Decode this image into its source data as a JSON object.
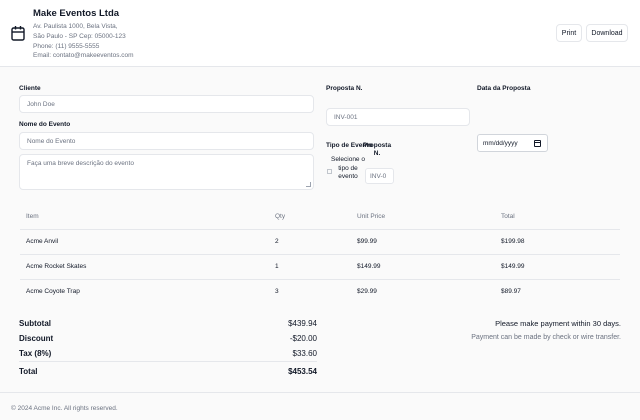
{
  "header": {
    "company_name": "Make Eventos Ltda",
    "address_lines": [
      "Av. Paulista 1000, Bela Vista,",
      "São Paulo - SP Cep: 05000-123",
      "Phone: (11) 9555-5555",
      "Email: contato@makeeventos.com"
    ],
    "print_label": "Print",
    "download_label": "Download",
    "icon": "calendar-icon"
  },
  "form": {
    "client_label": "Cliente",
    "client_placeholder": "John Doe",
    "event_name_label": "Nome do Evento",
    "event_name_placeholder": "Nome do Evento",
    "event_description_placeholder": "Faça uma breve descrição do evento",
    "proposal_number_label": "Proposta N.",
    "proposal_number_placeholder": "INV-001",
    "proposal_date_label": "Data da Proposta",
    "proposal_date_value": "mm/dd/yyyy",
    "event_type_label": "Tipo de Evento",
    "event_type_select": "Selecione o tipo de evento",
    "proposal_number_label_2": "Proposta N.",
    "proposal_number_placeholder_2": "INV-0"
  },
  "table": {
    "headers": [
      "Item",
      "Qty",
      "Unit Price",
      "Total"
    ],
    "rows": [
      {
        "item": "Acme Anvil",
        "qty": "2",
        "unit_price": "$99.99",
        "total": "$199.98"
      },
      {
        "item": "Acme Rocket Skates",
        "qty": "1",
        "unit_price": "$149.99",
        "total": "$149.99"
      },
      {
        "item": "Acme Coyote Trap",
        "qty": "3",
        "unit_price": "$29.99",
        "total": "$89.97"
      }
    ]
  },
  "summary": {
    "subtotal_label": "Subtotal",
    "subtotal_value": "$439.94",
    "discount_label": "Discount",
    "discount_value": "-$20.00",
    "tax_label": "Tax (8%)",
    "tax_value": "$33.60",
    "total_label": "Total",
    "total_value": "$453.54"
  },
  "payment": {
    "line1": "Please make payment within 30 days.",
    "line2": "Payment can be made by check or wire transfer."
  },
  "footer": {
    "copyright": "© 2024 Acme Inc. All rights reserved."
  }
}
